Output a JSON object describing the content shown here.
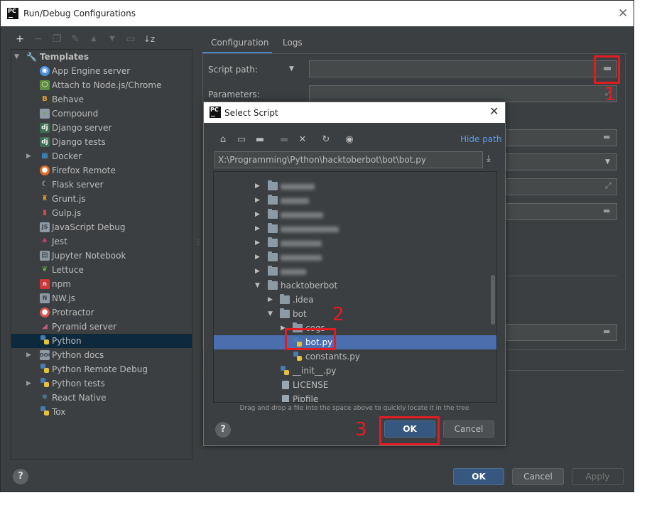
{
  "window": {
    "title": "Run/Debug Configurations",
    "logo": "PC"
  },
  "left_toolbar": {
    "icons": [
      "add-icon",
      "remove-icon",
      "copy-icon",
      "wrench-icon",
      "move-up-icon",
      "move-down-icon",
      "folder-add-icon",
      "sort-icon"
    ]
  },
  "tree": {
    "root_label": "Templates",
    "items": [
      {
        "label": "App Engine server",
        "icon": "app-engine-icon",
        "expandable": false
      },
      {
        "label": "Attach to Node.js/Chrome",
        "icon": "nodejs-icon",
        "expandable": false
      },
      {
        "label": "Behave",
        "icon": "behave-icon",
        "expandable": false
      },
      {
        "label": "Compound",
        "icon": "compound-icon",
        "expandable": false
      },
      {
        "label": "Django server",
        "icon": "django-icon",
        "expandable": false
      },
      {
        "label": "Django tests",
        "icon": "django-icon",
        "expandable": false
      },
      {
        "label": "Docker",
        "icon": "docker-icon",
        "expandable": true
      },
      {
        "label": "Firefox Remote",
        "icon": "firefox-icon",
        "expandable": false
      },
      {
        "label": "Flask server",
        "icon": "flask-icon",
        "expandable": false
      },
      {
        "label": "Grunt.js",
        "icon": "grunt-icon",
        "expandable": false
      },
      {
        "label": "Gulp.js",
        "icon": "gulp-icon",
        "expandable": false
      },
      {
        "label": "JavaScript Debug",
        "icon": "js-debug-icon",
        "expandable": false
      },
      {
        "label": "Jest",
        "icon": "jest-icon",
        "expandable": false
      },
      {
        "label": "Jupyter Notebook",
        "icon": "jupyter-icon",
        "expandable": false
      },
      {
        "label": "Lettuce",
        "icon": "lettuce-icon",
        "expandable": false
      },
      {
        "label": "npm",
        "icon": "npm-icon",
        "expandable": false
      },
      {
        "label": "NW.js",
        "icon": "nwjs-icon",
        "expandable": false
      },
      {
        "label": "Protractor",
        "icon": "protractor-icon",
        "expandable": false
      },
      {
        "label": "Pyramid server",
        "icon": "pyramid-icon",
        "expandable": false
      },
      {
        "label": "Python",
        "icon": "python-icon",
        "expandable": false,
        "selected": true
      },
      {
        "label": "Python docs",
        "icon": "python-docs-icon",
        "expandable": true
      },
      {
        "label": "Python Remote Debug",
        "icon": "python-remote-icon",
        "expandable": false
      },
      {
        "label": "Python tests",
        "icon": "python-tests-icon",
        "expandable": true
      },
      {
        "label": "React Native",
        "icon": "react-icon",
        "expandable": false
      },
      {
        "label": "Tox",
        "icon": "tox-icon",
        "expandable": false
      }
    ]
  },
  "tabs": [
    {
      "label": "Configuration",
      "active": true
    },
    {
      "label": "Logs",
      "active": false
    }
  ],
  "config": {
    "script_path_label": "Script path:",
    "script_path_value": "",
    "parameters_label": "Parameters:",
    "parameters_value": ""
  },
  "footer": {
    "help_label": "?",
    "ok_label": "OK",
    "cancel_label": "Cancel",
    "apply_label": "Apply"
  },
  "dialog": {
    "logo": "PC",
    "title": "Select Script",
    "toolbar_icons": [
      "home-icon",
      "desktop-icon",
      "project-icon",
      "new-folder-icon",
      "delete-icon",
      "refresh-icon",
      "show-hidden-icon"
    ],
    "hide_path_label": "Hide path",
    "path_value": "X:\\Programming\\Python\\hacktoberbot\\bot\\bot.py",
    "hint": "Drag and drop a file into the space above to quickly locate it in the tree",
    "help_label": "?",
    "ok_label": "OK",
    "cancel_label": "Cancel",
    "files": [
      {
        "label": "hacktoberbot",
        "type": "folder",
        "level": 0,
        "expanded": true
      },
      {
        "label": ".idea",
        "type": "folder",
        "level": 1,
        "expanded": false
      },
      {
        "label": "bot",
        "type": "folder",
        "level": 1,
        "expanded": true
      },
      {
        "label": "cogs",
        "type": "folder",
        "level": 2,
        "expanded": false
      },
      {
        "label": "bot.py",
        "type": "py",
        "level": 2,
        "selected": true
      },
      {
        "label": "constants.py",
        "type": "py",
        "level": 2
      },
      {
        "label": "__init__.py",
        "type": "py",
        "level": 1
      },
      {
        "label": "LICENSE",
        "type": "doc",
        "level": 1
      },
      {
        "label": "Pipfile",
        "type": "doc",
        "level": 1
      }
    ]
  },
  "annotations": {
    "marker_1": "1",
    "marker_2": "2",
    "marker_3": "3",
    "color": "#e21c23"
  },
  "colors": {
    "background": "#3c3f41",
    "selection": "#0d293e",
    "dialog_selection": "#4b6eaf",
    "primary_button": "#365880",
    "link": "#589df6"
  }
}
